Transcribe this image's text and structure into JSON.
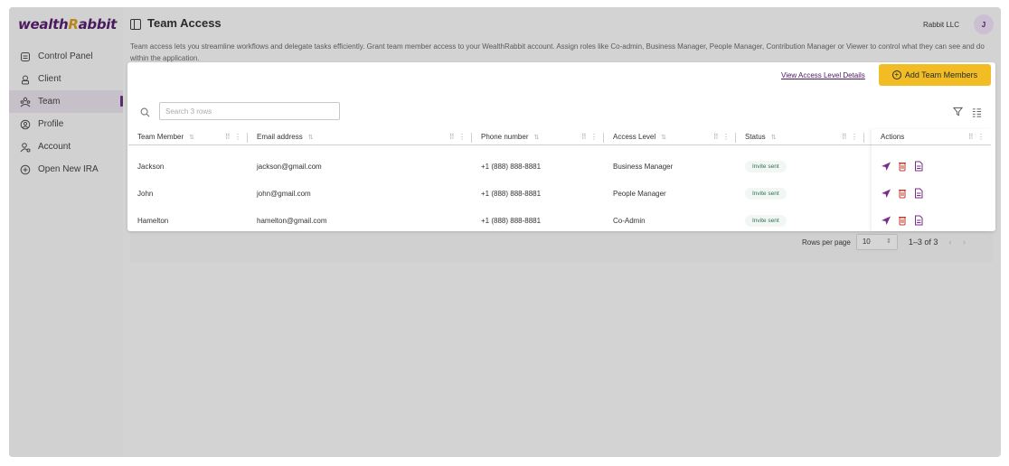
{
  "app": {
    "logo_main": "wealth",
    "logo_accent": "R",
    "logo_rest": "abbit",
    "org_name": "Rabbit LLC",
    "avatar_initial": "J"
  },
  "sidebar": {
    "items": [
      {
        "label": "Control Panel",
        "icon": "dashboard-icon"
      },
      {
        "label": "Client",
        "icon": "client-icon"
      },
      {
        "label": "Team",
        "icon": "team-icon",
        "active": true
      },
      {
        "label": "Profile",
        "icon": "profile-icon"
      },
      {
        "label": "Account",
        "icon": "account-icon"
      },
      {
        "label": "Open New IRA",
        "icon": "plus-circle-icon"
      }
    ]
  },
  "header": {
    "title": "Team Access",
    "description": "Team access lets you streamline workflows and delegate tasks efficiently. Grant team member access to your WealthRabbit account. Assign roles like Co-admin, Business Manager, People Manager, Contribution Manager or Viewer to control what they can see and do within the application."
  },
  "toolbar": {
    "view_link": "View Access Level Details",
    "add_button": "Add Team Members",
    "search_placeholder": "Search 3 rows"
  },
  "table": {
    "columns": [
      "Team Member",
      "Email address",
      "Phone number",
      "Access Level",
      "Status",
      "Actions"
    ],
    "rows": [
      {
        "name": "Jackson",
        "email": "jackson@gmail.com",
        "phone": "+1 (888) 888-8881",
        "access": "Business Manager",
        "status": "Invite sent"
      },
      {
        "name": "John",
        "email": "john@gmail.com",
        "phone": "+1 (888) 888-8881",
        "access": "People Manager",
        "status": "Invite sent"
      },
      {
        "name": "Hamelton",
        "email": "hamelton@gmail.com",
        "phone": "+1 (888) 888-8881",
        "access": "Co-Admin",
        "status": "Invite sent"
      }
    ]
  },
  "pagination": {
    "rows_per_page_label": "Rows per page",
    "rows_per_page_value": "10",
    "range": "1–3 of 3"
  },
  "colors": {
    "brand": "#4a1a5e",
    "accent": "#f2bd24",
    "action_icon": "#7b2d8e",
    "delete_icon": "#c0392b"
  }
}
